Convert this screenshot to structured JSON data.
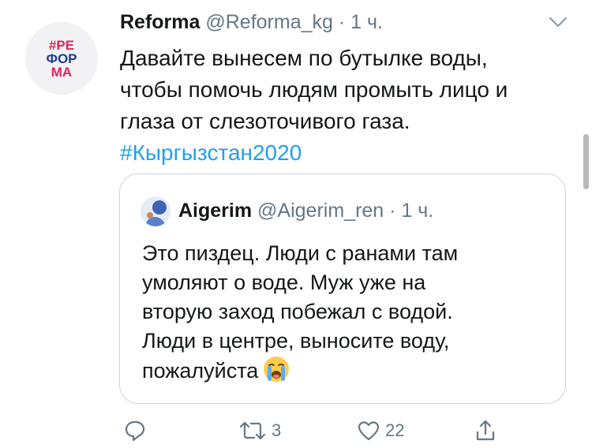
{
  "tweet": {
    "avatar_logo_lines": [
      "#РЕ",
      "ФОР",
      "МА"
    ],
    "display_name": "Reforma",
    "handle": "@Reforma_kg",
    "separator": "·",
    "time": "1 ч.",
    "text_lines": [
      "Давайте вынесем по бутылке воды,",
      "чтобы помочь людям промыть лицо и",
      "глаза от слезоточивого газа."
    ],
    "hashtag": "#Кыргызстан2020"
  },
  "quoted_tweet": {
    "display_name": "Aigerim",
    "handle": "@Aigerim_ren",
    "separator": "·",
    "time": "1 ч.",
    "text_lines": [
      "Это пиздец. Люди с ранами там",
      "умоляют о воде. Муж уже на",
      "вторую заход побежал с водой.",
      "Люди в центре, выносите воду,",
      "пожалуйста"
    ],
    "emoji": "crying-face-emoji"
  },
  "actions": {
    "reply_count": "",
    "retweet_count": "3",
    "like_count": "22"
  },
  "icons": {
    "menu": "chevron-down-icon",
    "reply": "reply-icon",
    "retweet": "retweet-icon",
    "like": "heart-icon",
    "share": "share-icon"
  },
  "colors": {
    "link": "#1da1f2",
    "muted": "#657786",
    "text": "#14171a",
    "border": "#ccd6dd",
    "brand_pink": "#e0245e",
    "brand_blue": "#1f3a8f"
  }
}
